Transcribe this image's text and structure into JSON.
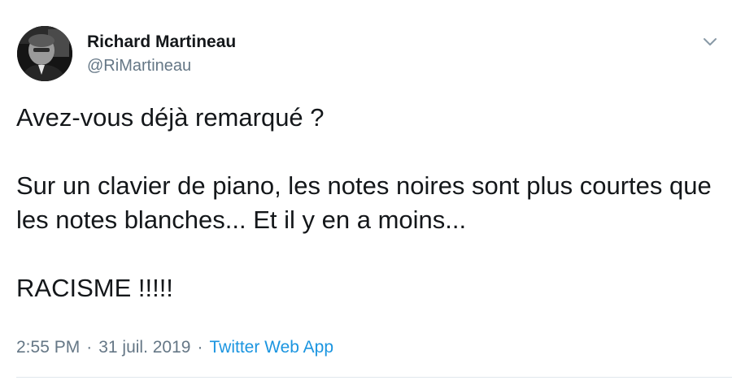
{
  "author": {
    "display_name": "Richard Martineau",
    "handle": "@RiMartineau"
  },
  "tweet": {
    "lines": [
      "Avez-vous déjà remarqué ?",
      "Sur un clavier de piano, les notes noires sont plus courtes que les notes blanches... Et il y en a moins...",
      "RACISME !!!!!"
    ]
  },
  "meta": {
    "time": "2:55 PM",
    "separator": "·",
    "date": "31 juil. 2019",
    "source": "Twitter Web App"
  },
  "icons": {
    "menu": "chevron-down-icon",
    "avatar": "profile-photo"
  },
  "colors": {
    "text": "#14171a",
    "secondary": "#657786",
    "link": "#1b95e0",
    "divider": "#e1e8ed"
  }
}
